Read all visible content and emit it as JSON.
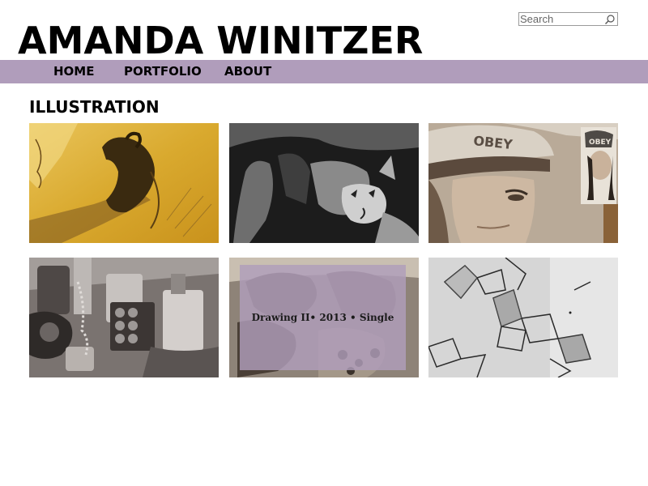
{
  "site": {
    "title": "AMANDA WINITZER"
  },
  "search": {
    "placeholder": "Search"
  },
  "nav": {
    "items": [
      {
        "label": "HOME"
      },
      {
        "label": "PORTFOLIO"
      },
      {
        "label": "ABOUT"
      }
    ]
  },
  "section": {
    "title": "ILLUSTRATION"
  },
  "gallery": {
    "items": [
      {
        "image": "yellow-hand-drawing"
      },
      {
        "image": "wolf-drawing"
      },
      {
        "image": "obey-cap-portrait",
        "texts": [
          "OBEY",
          "OBEY"
        ]
      },
      {
        "image": "still-life-drawing"
      },
      {
        "image": "figure-drawing",
        "caption": "Drawing II• 2013 • Single"
      },
      {
        "image": "geometric-figure-drawing"
      }
    ]
  },
  "colors": {
    "nav_background": "#b09dbb",
    "overlay": "#b09dbb",
    "text": "#000000"
  }
}
